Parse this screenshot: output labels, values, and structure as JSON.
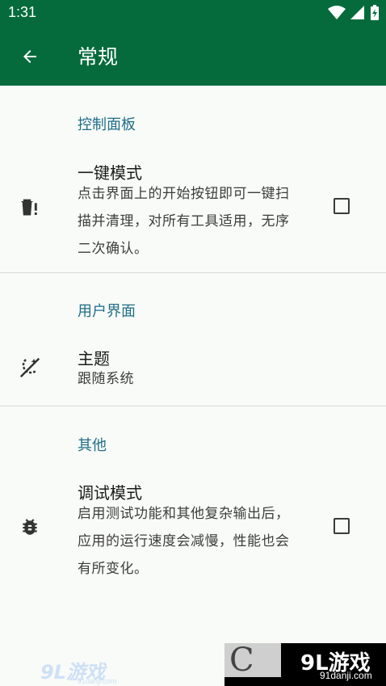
{
  "status_bar": {
    "time": "1:31"
  },
  "app_bar": {
    "title": "常规"
  },
  "sections": {
    "control_panel": {
      "header": "控制面板",
      "one_click": {
        "title": "一键模式",
        "summary": "点击界面上的开始按钮即可一键扫描并清理，对所有工具适用，无序二次确认。",
        "checked": false
      }
    },
    "user_interface": {
      "header": "用户界面",
      "theme": {
        "title": "主题",
        "summary": "跟随系统"
      }
    },
    "other": {
      "header": "其他",
      "debug": {
        "title": "调试模式",
        "summary": "启用测试功能和其他复杂输出后，应用的运行速度会减慢，性能也会有所变化。",
        "checked": false
      }
    }
  },
  "watermark": {
    "logo_text": "9L游戏",
    "url": "91danji.com",
    "left_logo": "9L游戏",
    "left_url": "91danji.com"
  },
  "colors": {
    "primary": "#056b3c",
    "accent_text": "#1f6d8a",
    "background": "#f8fbf7"
  }
}
